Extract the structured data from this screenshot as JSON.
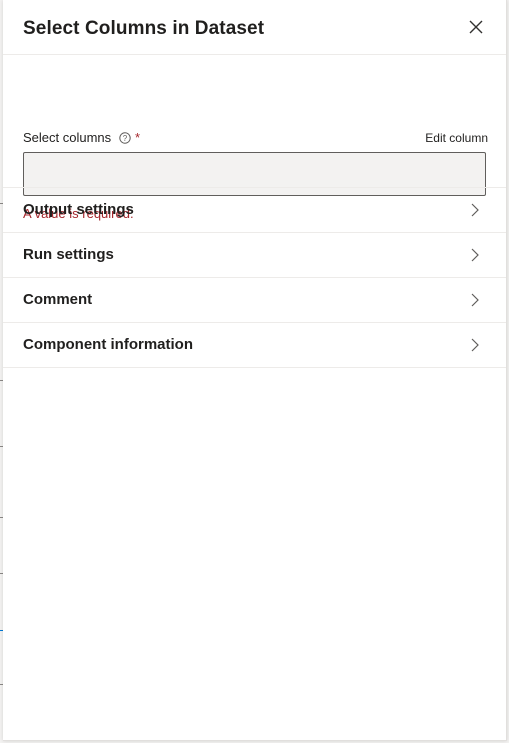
{
  "panel": {
    "title": "Select Columns in Dataset",
    "close_icon": "close-icon"
  },
  "field": {
    "label": "Select columns",
    "info_icon": "info-icon",
    "required_marker": "*",
    "edit_link": "Edit column",
    "value": "",
    "error": "A value is required."
  },
  "sections": [
    {
      "label": "Output settings",
      "icon": "chevron-right-icon"
    },
    {
      "label": "Run settings",
      "icon": "chevron-right-icon"
    },
    {
      "label": "Comment",
      "icon": "chevron-right-icon"
    },
    {
      "label": "Component information",
      "icon": "chevron-right-icon"
    }
  ],
  "colors": {
    "error": "#a4262c",
    "input_background": "#f3f2f1",
    "divider": "#edebe9",
    "text": "#201f1e"
  }
}
